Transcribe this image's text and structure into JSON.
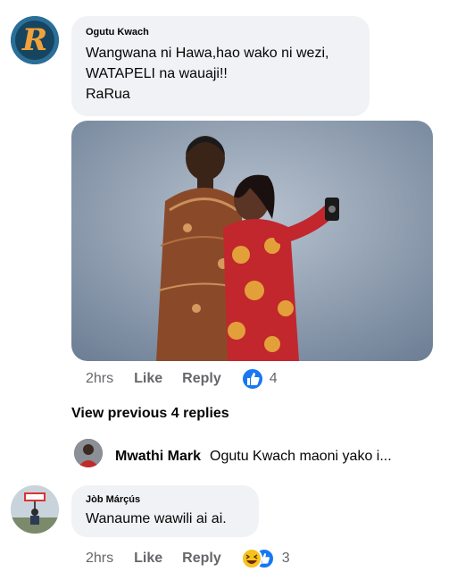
{
  "top_hint": "",
  "comments": [
    {
      "author": "Ogutu Kwach",
      "lines": [
        "Wangwana ni Hawa,hao wako ni wezi,",
        "WATAPELI na wauaji!!",
        "RaRua"
      ],
      "time": "2hrs",
      "like_label": "Like",
      "reply_label": "Reply",
      "reaction_count": "4",
      "reactions": [
        "like"
      ]
    },
    {
      "author": "Jòb Márçús",
      "lines": [
        "Wanaume wawili ai ai."
      ],
      "time": "2hrs",
      "like_label": "Like",
      "reply_label": "Reply",
      "reaction_count": "3",
      "reactions": [
        "haha",
        "like"
      ]
    }
  ],
  "view_previous": "View previous 4 replies",
  "reply_preview": {
    "author": "Mwathi Mark",
    "text": "Ogutu Kwach maoni yako i..."
  },
  "colors": {
    "bubble": "#f0f2f5",
    "like_blue": "#1877f2",
    "meta_gray": "#65676b"
  }
}
